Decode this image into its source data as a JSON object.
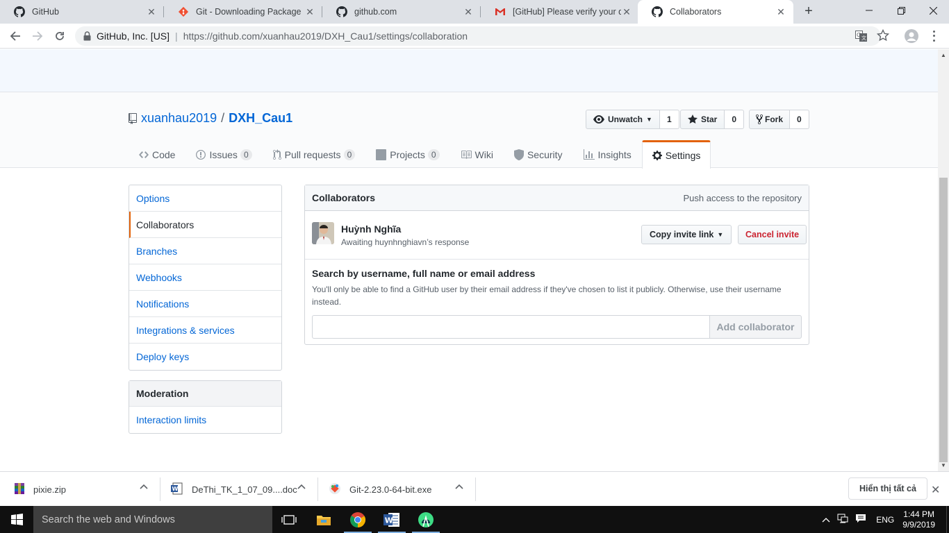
{
  "browser": {
    "tabs": [
      {
        "title": "GitHub",
        "icon": "github-icon"
      },
      {
        "title": "Git - Downloading Package",
        "icon": "git-icon"
      },
      {
        "title": "github.com",
        "icon": "github-icon"
      },
      {
        "title": "[GitHub] Please verify your dev",
        "icon": "gmail-icon"
      },
      {
        "title": "Collaborators",
        "icon": "github-icon",
        "active": true
      }
    ],
    "new_tab": "+",
    "address": {
      "org": "GitHub, Inc. [US]",
      "divider": "|",
      "url_host": "https://github.com/",
      "url_path": "xuanhau2019/DXH_Cau1/settings/collaboration"
    }
  },
  "repo": {
    "owner": "xuanhau2019",
    "separator": "/",
    "name": "DXH_Cau1",
    "actions": {
      "watch": {
        "label": "Unwatch",
        "count": "1"
      },
      "star": {
        "label": "Star",
        "count": "0"
      },
      "fork": {
        "label": "Fork",
        "count": "0"
      }
    },
    "nav": {
      "code": "Code",
      "issues": {
        "label": "Issues",
        "count": "0"
      },
      "pulls": {
        "label": "Pull requests",
        "count": "0"
      },
      "projects": {
        "label": "Projects",
        "count": "0"
      },
      "wiki": "Wiki",
      "security": "Security",
      "insights": "Insights",
      "settings": "Settings"
    }
  },
  "settings_menu": {
    "items": [
      "Options",
      "Collaborators",
      "Branches",
      "Webhooks",
      "Notifications",
      "Integrations & services",
      "Deploy keys"
    ],
    "selected": "Collaborators",
    "moderation": {
      "heading": "Moderation",
      "items": [
        "Interaction limits"
      ]
    }
  },
  "collaborators": {
    "title": "Collaborators",
    "note": "Push access to the repository",
    "pending": {
      "name": "Huỳnh Nghĩa",
      "status": "Awaiting huynhnghiavn’s response",
      "copy_label": "Copy invite link",
      "cancel_label": "Cancel invite"
    },
    "search": {
      "label": "Search by username, full name or email address",
      "note": "You'll only be able to find a GitHub user by their email address if they've chosen to list it publicly. Otherwise, use their username instead.",
      "value": "",
      "button": "Add collaborator"
    }
  },
  "downloads": {
    "items": [
      {
        "name": "pixie.zip",
        "icon": "archive-icon"
      },
      {
        "name": "DeThi_TK_1_07_09....doc",
        "icon": "word-doc-icon"
      },
      {
        "name": "Git-2.23.0-64-bit.exe",
        "icon": "git-installer-icon"
      }
    ],
    "show_all": "Hiển thị tất cả"
  },
  "taskbar": {
    "search_placeholder": "Search the web and Windows",
    "language": "ENG",
    "time": "1:44 PM",
    "date": "9/9/2019"
  },
  "colors": {
    "link": "#0366d6",
    "selected_accent": "#e36209",
    "danger": "#cb2431"
  }
}
